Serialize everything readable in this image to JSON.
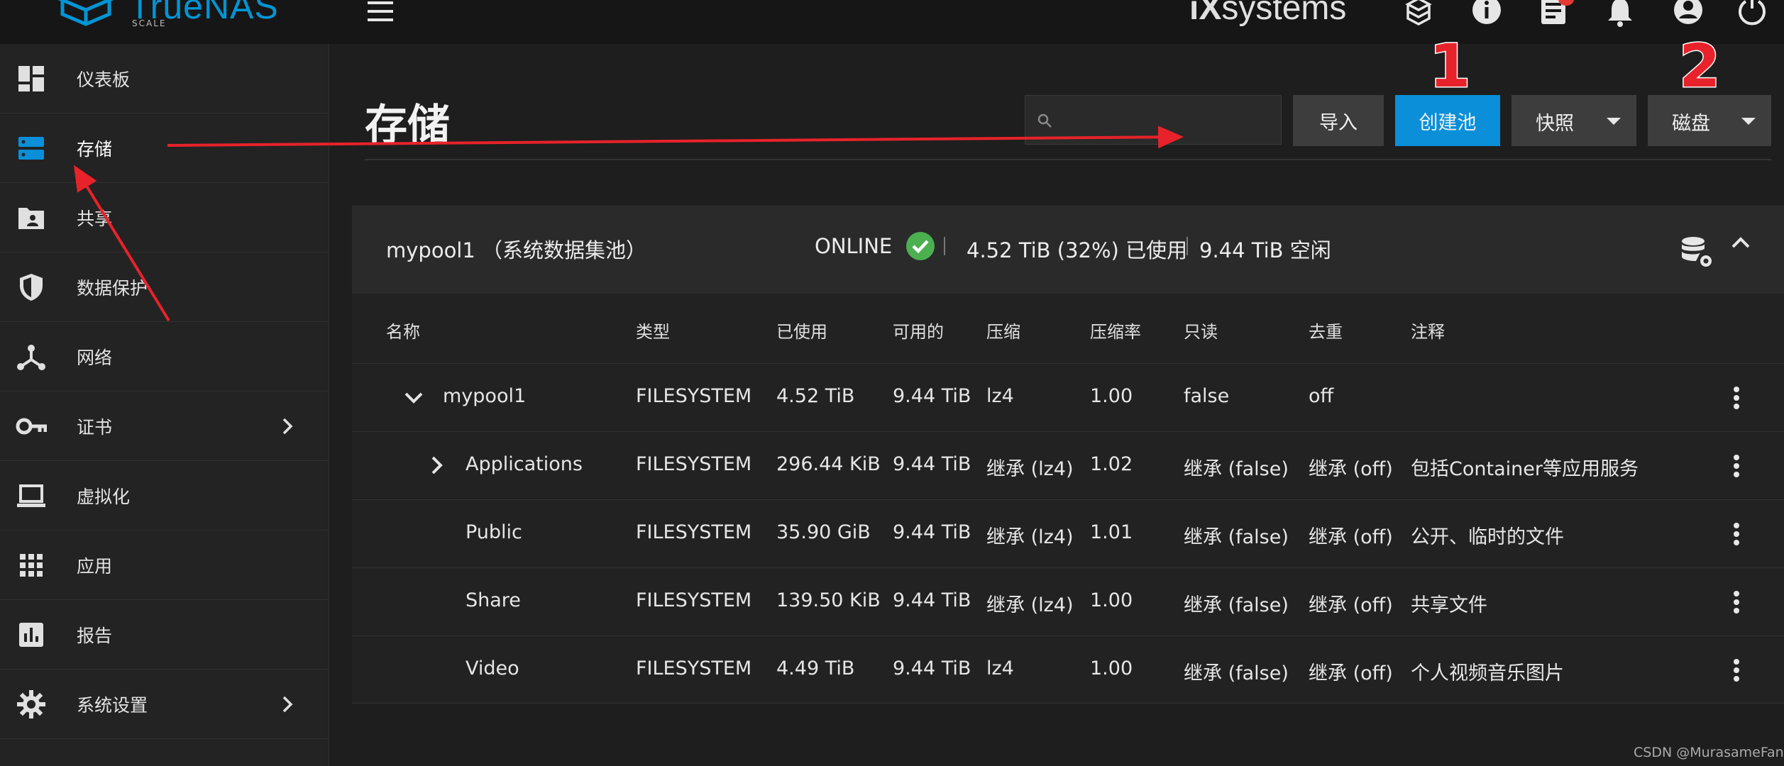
{
  "topbar": {
    "logo_text": "TrueNAS",
    "logo_sub": "SCALE",
    "brand_prefix": "iX",
    "brand_suffix": "systems",
    "icons": [
      "truecommand-icon",
      "info-icon",
      "task-list-icon",
      "bell-icon",
      "account-icon",
      "power-icon"
    ]
  },
  "sidebar": {
    "items": [
      {
        "label": "仪表板",
        "icon": "dashboard-icon"
      },
      {
        "label": "存储",
        "icon": "storage-icon"
      },
      {
        "label": "共享",
        "icon": "share-folder-icon"
      },
      {
        "label": "数据保护",
        "icon": "shield-icon"
      },
      {
        "label": "网络",
        "icon": "network-icon"
      },
      {
        "label": "证书",
        "icon": "key-icon"
      },
      {
        "label": "虚拟化",
        "icon": "laptop-icon"
      },
      {
        "label": "应用",
        "icon": "apps-grid-icon"
      },
      {
        "label": "报告",
        "icon": "report-chart-icon"
      },
      {
        "label": "系统设置",
        "icon": "gear-icon"
      }
    ]
  },
  "main": {
    "title": "存储",
    "search_placeholder": "",
    "buttons": {
      "import": "导入",
      "create_pool": "创建池",
      "snapshot": "快照",
      "disks": "磁盘"
    }
  },
  "pool": {
    "name": "mypool1",
    "system_tag": "（系统数据集池）",
    "status": "ONLINE",
    "used": "4.52 TiB (32%) 已使用",
    "free": "9.44 TiB 空闲",
    "columns": [
      "名称",
      "类型",
      "已使用",
      "可用的",
      "压缩",
      "压缩率",
      "只读",
      "去重",
      "注释"
    ],
    "rows": [
      {
        "name": "mypool1",
        "type": "FILESYSTEM",
        "used": "4.52 TiB",
        "avail": "9.44 TiB",
        "compression": "lz4",
        "ratio": "1.00",
        "readonly": "false",
        "dedup": "off",
        "comment": ""
      },
      {
        "name": "Applications",
        "type": "FILESYSTEM",
        "used": "296.44 KiB",
        "avail": "9.44 TiB",
        "compression": "继承 (lz4)",
        "ratio": "1.02",
        "readonly": "继承 (false)",
        "dedup": "继承 (off)",
        "comment": "包括Container等应用服务"
      },
      {
        "name": "Public",
        "type": "FILESYSTEM",
        "used": "35.90 GiB",
        "avail": "9.44 TiB",
        "compression": "继承 (lz4)",
        "ratio": "1.01",
        "readonly": "继承 (false)",
        "dedup": "继承 (off)",
        "comment": "公开、临时的文件"
      },
      {
        "name": "Share",
        "type": "FILESYSTEM",
        "used": "139.50 KiB",
        "avail": "9.44 TiB",
        "compression": "继承 (lz4)",
        "ratio": "1.00",
        "readonly": "继承 (false)",
        "dedup": "继承 (off)",
        "comment": "共享文件"
      },
      {
        "name": "Video",
        "type": "FILESYSTEM",
        "used": "4.49 TiB",
        "avail": "9.44 TiB",
        "compression": "lz4",
        "ratio": "1.00",
        "readonly": "继承 (false)",
        "dedup": "继承 (off)",
        "comment": "个人视频音乐图片"
      }
    ]
  },
  "annotations": {
    "label_1": "1",
    "label_2": "2",
    "arrow_color": "#e8222a"
  },
  "watermark": "CSDN @MurasameFan",
  "colors": {
    "accent": "#0a8fd8",
    "online_ok": "#4caf50",
    "background": "#1e1e1e"
  }
}
